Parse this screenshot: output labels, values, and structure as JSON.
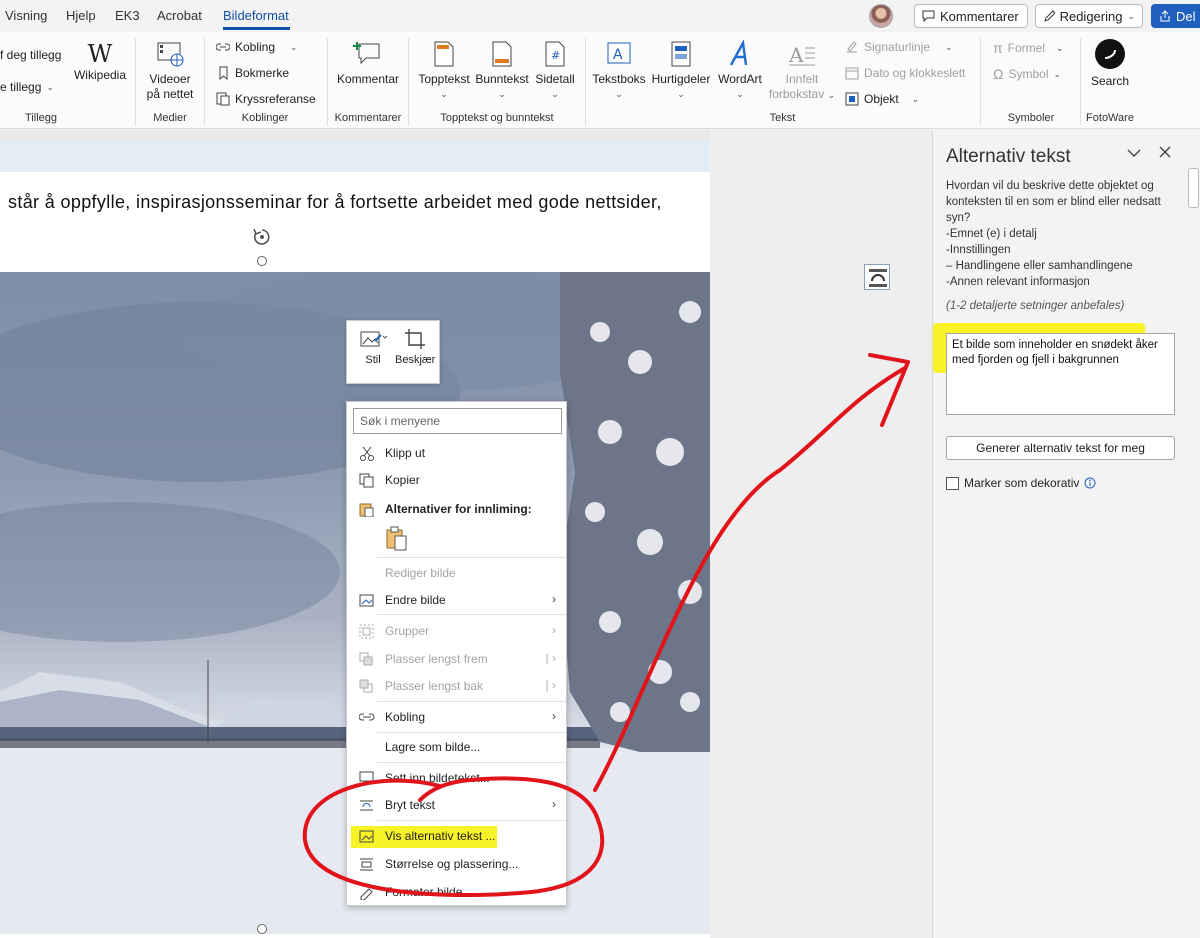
{
  "tabs": [
    "Visning",
    "Hjelp",
    "EK3",
    "Acrobat",
    "Bildeformat"
  ],
  "topbar": {
    "comments_label": "Kommentarer",
    "editing_label": "Redigering",
    "share_label": "Del"
  },
  "ribbon": {
    "addins": {
      "get_addins": "f deg tillegg",
      "my_addins": "e tillegg",
      "wikipedia": "Wikipedia",
      "group": "Tillegg"
    },
    "media": {
      "online_videos_line1": "Videoer",
      "online_videos_line2": "på nettet",
      "group": "Medier"
    },
    "links": {
      "link": "Kobling",
      "bookmark": "Bokmerke",
      "cross_reference": "Kryssreferanse",
      "group": "Koblinger"
    },
    "comments": {
      "comment": "Kommentar",
      "group": "Kommentarer"
    },
    "header_footer": {
      "header": "Topptekst",
      "footer": "Bunntekst",
      "page_number": "Sidetall",
      "group": "Topptekst og bunntekst"
    },
    "text": {
      "textbox": "Tekstboks",
      "quick_parts": "Hurtigdeler",
      "wordart": "WordArt",
      "dropcap_line1": "Innfelt",
      "dropcap_line2": "forbokstav",
      "signature_line": "Signaturlinje",
      "date_time": "Dato og klokkeslett",
      "object": "Objekt",
      "group": "Tekst"
    },
    "symbols": {
      "equation": "Formel",
      "symbol": "Symbol",
      "group": "Symboler"
    },
    "fotoware": {
      "search": "Search",
      "group": "FotoWare"
    }
  },
  "document": {
    "body_text": "står å oppfylle, inspirasjonsseminar for å fortsette arbeidet med gode nettsider,"
  },
  "mini_toolbar": {
    "style": "Stil",
    "crop": "Beskjær"
  },
  "context_menu": {
    "search_placeholder": "Søk i menyene",
    "cut": "Klipp ut",
    "copy": "Kopier",
    "paste_options": "Alternativer for innliming:",
    "edit_picture": "Rediger bilde",
    "change_picture": "Endre bilde",
    "group": "Grupper",
    "bring_forward": "Plasser lengst frem",
    "send_backward": "Plasser lengst bak",
    "link": "Kobling",
    "save_as_picture": "Lagre som bilde...",
    "insert_caption": "Sett inn bildetekst...",
    "wrap_text": "Bryt tekst",
    "view_alt_text": "Vis alternativ tekst ...",
    "size_position": "Størrelse og plassering...",
    "format_picture": "Formater bilde..."
  },
  "alt_panel": {
    "title": "Alternativ tekst",
    "description": "Hvordan vil du beskrive dette objektet og konteksten til en som er blind eller nedsatt syn?",
    "bullets": [
      "-Emnet (e) i detalj",
      "-Innstillingen",
      "– Handlingene eller samhandlingene",
      "-Annen relevant informasjon"
    ],
    "hint": "(1-2 detaljerte setninger anbefales)",
    "alt_text_value": "Et bilde som inneholder en snødekt åker med fjorden og fjell i bakgrunnen",
    "generate_button": "Generer alternativ tekst for meg",
    "decorative_label": "Marker som dekorativ"
  },
  "colors": {
    "accent": "#0f4fa8",
    "share": "#1f5fbd",
    "highlight": "#f7f21a",
    "annotation": "#e0141a"
  }
}
